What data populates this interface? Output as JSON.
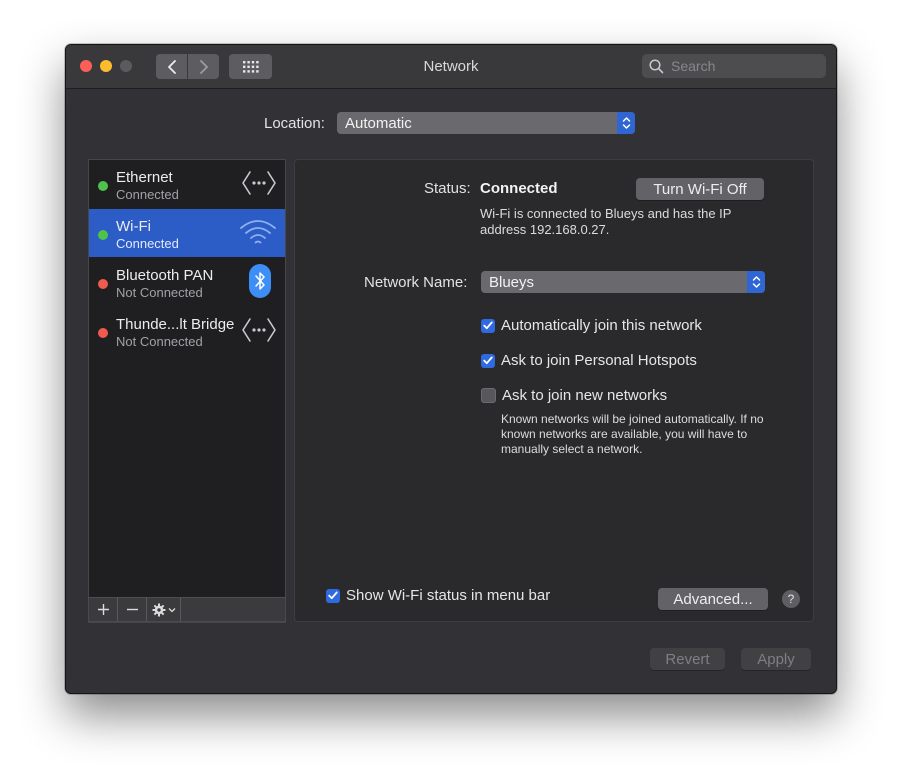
{
  "window": {
    "title": "Network",
    "search_placeholder": "Search"
  },
  "location": {
    "label": "Location:",
    "value": "Automatic"
  },
  "services": [
    {
      "name": "Ethernet",
      "state": "Connected",
      "status_color": "#4ec34b",
      "icon": "ethernet-icon"
    },
    {
      "name": "Wi-Fi",
      "state": "Connected",
      "status_color": "#4ec34b",
      "icon": "wifi-icon",
      "selected": true
    },
    {
      "name": "Bluetooth PAN",
      "state": "Not Connected",
      "status_color": "#ef5b4f",
      "icon": "bluetooth-icon"
    },
    {
      "name": "Thunde...lt Bridge",
      "state": "Not Connected",
      "status_color": "#ef5b4f",
      "icon": "ethernet-icon"
    }
  ],
  "sidebar_controls": {
    "add": "+",
    "remove": "—"
  },
  "detail": {
    "status_label": "Status:",
    "status_value": "Connected",
    "turn_off_button": "Turn Wi-Fi Off",
    "status_description": "Wi-Fi is connected to Blueys and has the IP address 192.168.0.27.",
    "network_name_label": "Network Name:",
    "network_name_value": "Blueys",
    "auto_join": {
      "label": "Automatically join this network",
      "checked": true
    },
    "personal_hotspots": {
      "label": "Ask to join Personal Hotspots",
      "checked": true
    },
    "new_networks": {
      "label": "Ask to join new networks",
      "checked": false
    },
    "known_networks_note": "Known networks will be joined automatically. If no known networks are available, you will have to manually select a network.",
    "show_menubar": {
      "label": "Show Wi-Fi status in menu bar",
      "checked": true
    },
    "advanced_button": "Advanced...",
    "help_button": "?"
  },
  "footer": {
    "revert_button": "Revert",
    "apply_button": "Apply"
  },
  "colors": {
    "accent": "#2c5cc5",
    "checkbox": "#2f6ae0",
    "status_connected": "#4ec34b",
    "status_disconnected": "#ef5b4f"
  }
}
